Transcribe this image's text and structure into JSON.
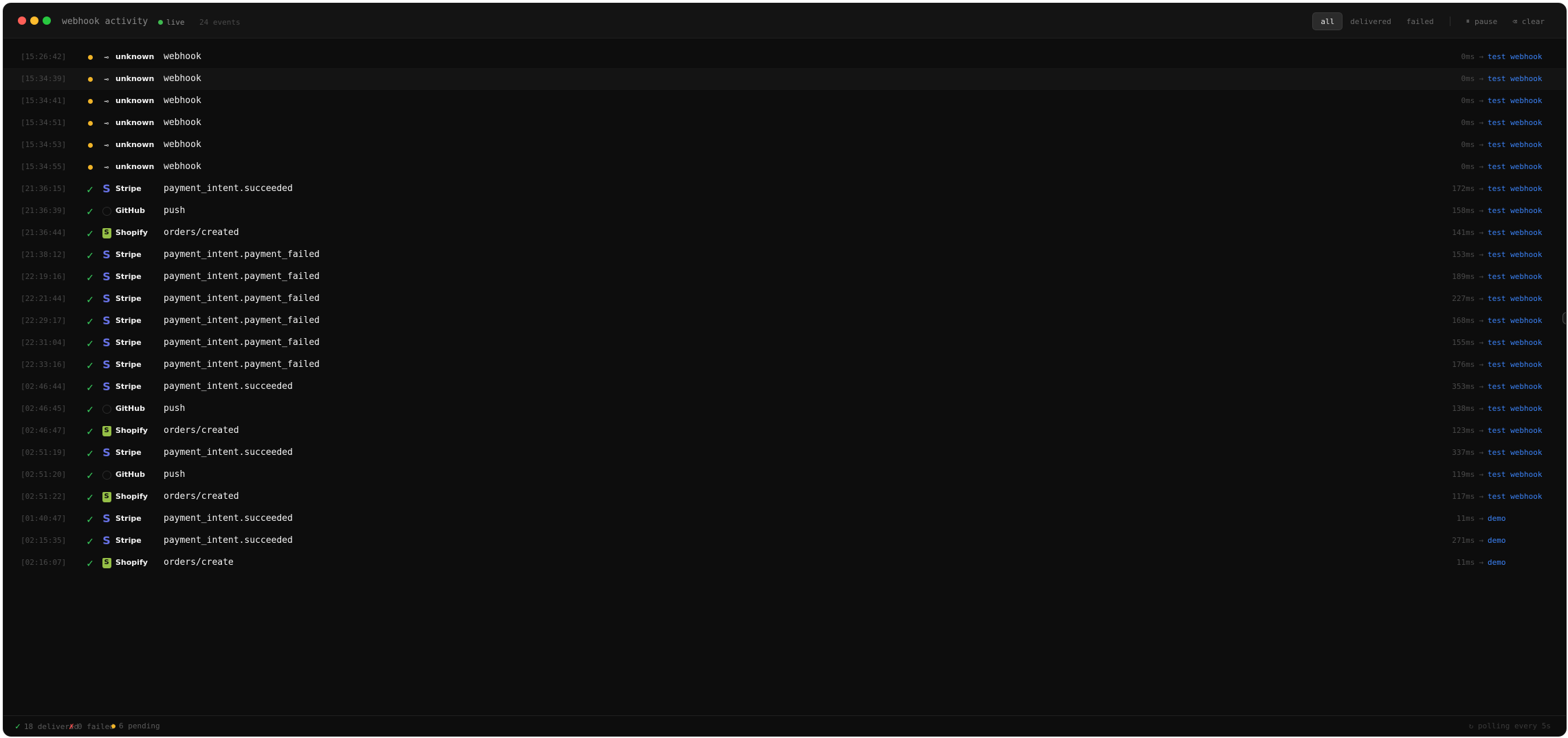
{
  "window": {
    "title": "webhook activity",
    "live_label": "live",
    "events_count": "24 events"
  },
  "filters": {
    "all": "all",
    "delivered": "delivered",
    "failed": "failed",
    "pause": "pause",
    "pause_glyph": "⏸",
    "clear": "clear",
    "clear_glyph": "⌫"
  },
  "colors": {
    "accent_link": "#3b82f6",
    "delivered": "#3ad15f",
    "pending": "#f0b429",
    "failed": "#f04b4b",
    "stripe": "#6772e5",
    "shopify": "#95bf47"
  },
  "events": [
    {
      "time": "[15:26:42]",
      "status": "pending",
      "source": "unknown",
      "source_icon": "unknown-arrow-icon",
      "event": "webhook",
      "duration": "0ms",
      "arrow": "→",
      "destination": "test webhook"
    },
    {
      "time": "[15:34:39]",
      "status": "pending",
      "source": "unknown",
      "source_icon": "unknown-arrow-icon",
      "event": "webhook",
      "duration": "0ms",
      "arrow": "→",
      "destination": "test webhook"
    },
    {
      "time": "[15:34:41]",
      "status": "pending",
      "source": "unknown",
      "source_icon": "unknown-arrow-icon",
      "event": "webhook",
      "duration": "0ms",
      "arrow": "→",
      "destination": "test webhook"
    },
    {
      "time": "[15:34:51]",
      "status": "pending",
      "source": "unknown",
      "source_icon": "unknown-arrow-icon",
      "event": "webhook",
      "duration": "0ms",
      "arrow": "→",
      "destination": "test webhook"
    },
    {
      "time": "[15:34:53]",
      "status": "pending",
      "source": "unknown",
      "source_icon": "unknown-arrow-icon",
      "event": "webhook",
      "duration": "0ms",
      "arrow": "→",
      "destination": "test webhook"
    },
    {
      "time": "[15:34:55]",
      "status": "pending",
      "source": "unknown",
      "source_icon": "unknown-arrow-icon",
      "event": "webhook",
      "duration": "0ms",
      "arrow": "→",
      "destination": "test webhook"
    },
    {
      "time": "[21:36:15]",
      "status": "delivered",
      "source": "Stripe",
      "source_icon": "stripe-icon",
      "event": "payment_intent.succeeded",
      "duration": "172ms",
      "arrow": "→",
      "destination": "test webhook"
    },
    {
      "time": "[21:36:39]",
      "status": "delivered",
      "source": "GitHub",
      "source_icon": "github-icon",
      "event": "push",
      "duration": "158ms",
      "arrow": "→",
      "destination": "test webhook"
    },
    {
      "time": "[21:36:44]",
      "status": "delivered",
      "source": "Shopify",
      "source_icon": "shopify-icon",
      "event": "orders/created",
      "duration": "141ms",
      "arrow": "→",
      "destination": "test webhook"
    },
    {
      "time": "[21:38:12]",
      "status": "delivered",
      "source": "Stripe",
      "source_icon": "stripe-icon",
      "event": "payment_intent.payment_failed",
      "duration": "153ms",
      "arrow": "→",
      "destination": "test webhook"
    },
    {
      "time": "[22:19:16]",
      "status": "delivered",
      "source": "Stripe",
      "source_icon": "stripe-icon",
      "event": "payment_intent.payment_failed",
      "duration": "189ms",
      "arrow": "→",
      "destination": "test webhook"
    },
    {
      "time": "[22:21:44]",
      "status": "delivered",
      "source": "Stripe",
      "source_icon": "stripe-icon",
      "event": "payment_intent.payment_failed",
      "duration": "227ms",
      "arrow": "→",
      "destination": "test webhook"
    },
    {
      "time": "[22:29:17]",
      "status": "delivered",
      "source": "Stripe",
      "source_icon": "stripe-icon",
      "event": "payment_intent.payment_failed",
      "duration": "168ms",
      "arrow": "→",
      "destination": "test webhook"
    },
    {
      "time": "[22:31:04]",
      "status": "delivered",
      "source": "Stripe",
      "source_icon": "stripe-icon",
      "event": "payment_intent.payment_failed",
      "duration": "155ms",
      "arrow": "→",
      "destination": "test webhook"
    },
    {
      "time": "[22:33:16]",
      "status": "delivered",
      "source": "Stripe",
      "source_icon": "stripe-icon",
      "event": "payment_intent.payment_failed",
      "duration": "176ms",
      "arrow": "→",
      "destination": "test webhook"
    },
    {
      "time": "[02:46:44]",
      "status": "delivered",
      "source": "Stripe",
      "source_icon": "stripe-icon",
      "event": "payment_intent.succeeded",
      "duration": "353ms",
      "arrow": "→",
      "destination": "test webhook"
    },
    {
      "time": "[02:46:45]",
      "status": "delivered",
      "source": "GitHub",
      "source_icon": "github-icon",
      "event": "push",
      "duration": "138ms",
      "arrow": "→",
      "destination": "test webhook"
    },
    {
      "time": "[02:46:47]",
      "status": "delivered",
      "source": "Shopify",
      "source_icon": "shopify-icon",
      "event": "orders/created",
      "duration": "123ms",
      "arrow": "→",
      "destination": "test webhook"
    },
    {
      "time": "[02:51:19]",
      "status": "delivered",
      "source": "Stripe",
      "source_icon": "stripe-icon",
      "event": "payment_intent.succeeded",
      "duration": "337ms",
      "arrow": "→",
      "destination": "test webhook"
    },
    {
      "time": "[02:51:20]",
      "status": "delivered",
      "source": "GitHub",
      "source_icon": "github-icon",
      "event": "push",
      "duration": "119ms",
      "arrow": "→",
      "destination": "test webhook"
    },
    {
      "time": "[02:51:22]",
      "status": "delivered",
      "source": "Shopify",
      "source_icon": "shopify-icon",
      "event": "orders/created",
      "duration": "117ms",
      "arrow": "→",
      "destination": "test webhook"
    },
    {
      "time": "[01:40:47]",
      "status": "delivered",
      "source": "Stripe",
      "source_icon": "stripe-icon",
      "event": "payment_intent.succeeded",
      "duration": "11ms",
      "arrow": "→",
      "destination": "demo"
    },
    {
      "time": "[02:15:35]",
      "status": "delivered",
      "source": "Stripe",
      "source_icon": "stripe-icon",
      "event": "payment_intent.succeeded",
      "duration": "271ms",
      "arrow": "→",
      "destination": "demo"
    },
    {
      "time": "[02:16:07]",
      "status": "delivered",
      "source": "Shopify",
      "source_icon": "shopify-icon",
      "event": "orders/create",
      "duration": "11ms",
      "arrow": "→",
      "destination": "demo"
    }
  ],
  "footer": {
    "delivered": "18 delivered",
    "failed": "0 failed",
    "pending": "6 pending",
    "polling": "↻ polling every 5s",
    "delivered_glyph": "✓",
    "failed_glyph": "✗"
  }
}
